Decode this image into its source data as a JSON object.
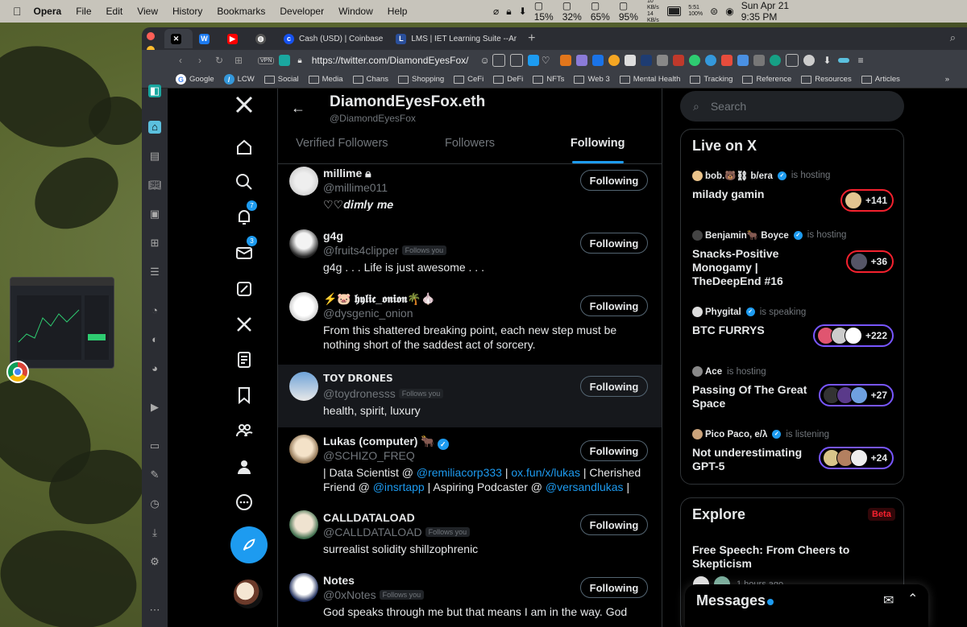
{
  "menubar": {
    "app": "Opera",
    "menus": [
      "File",
      "Edit",
      "View",
      "History",
      "Bookmarks",
      "Developer",
      "Window",
      "Help"
    ],
    "stats": {
      "cpu": "15%",
      "mem": "32%",
      "disk": "65%",
      "battery_stat": "95%"
    },
    "net": {
      "up": "10 KB/s",
      "down": "14 KB/s"
    },
    "battery": {
      "time": "5:51",
      "pct": "100%"
    },
    "datetime": "Sun Apr 21  9:35 PM"
  },
  "browser": {
    "tabs": [
      {
        "label": ""
      },
      {
        "label": ""
      },
      {
        "label": ""
      },
      {
        "label": ""
      },
      {
        "label": "Cash (USD) | Coinbase"
      },
      {
        "label": "LMS | IET Learning Suite --Ar"
      }
    ],
    "vpn": "VPN",
    "url": "https://twitter.com/DiamondEyesFox/",
    "bookmarks": [
      "Google",
      "LCW",
      "Social",
      "Media",
      "Chans",
      "Shopping",
      "CeFi",
      "DeFi",
      "NFTs",
      "Web 3",
      "Mental Health",
      "Tracking",
      "Reference",
      "Resources",
      "Articles"
    ]
  },
  "nav": {
    "notifications_badge": "7",
    "messages_badge": "3"
  },
  "profile": {
    "name": "DiamondEyesFox.eth",
    "handle": "@DiamondEyesFox",
    "tabs": [
      "Verified Followers",
      "Followers",
      "Following"
    ]
  },
  "following": [
    {
      "name": "millime",
      "handle": "@millime011",
      "follows_you": "",
      "bio": "♡♡𝒅𝒊𝒎𝒍𝒚 𝒎𝒆",
      "button": "Following"
    },
    {
      "name": "g4g",
      "handle": "@fruits4clipper",
      "follows_you": "Follows you",
      "bio": "g4g . . . Life is just awesome . . .",
      "button": "Following"
    },
    {
      "name": "⚡🐷 𝖍𝖞𝖑𝖎𝖈_𝖔𝖓𝖎𝖔𝖓🌴🧄",
      "handle": "@dysgenic_onion",
      "follows_you": "",
      "bio": "From this shattered breaking point, each new step must be nothing short of the saddest act of sorcery.",
      "button": "Following"
    },
    {
      "name": "𝗧𝗢𝗬 𝗗𝗥𝗢𝗡𝗘𝗦",
      "handle": "@toydronesss",
      "follows_you": "Follows you",
      "bio": "health, spirit, luxury",
      "button": "Following"
    },
    {
      "name": "Lukas (computer) 🐂",
      "handle": "@SCHIZO_FREQ",
      "follows_you": "",
      "bio_parts": [
        "| Data Scientist @ ",
        "@remiliacorp333",
        " | ",
        "ox.fun/x/lukas",
        " | Cherished Friend @ ",
        "@insrtapp",
        " | Aspiring Podcaster @ ",
        "@versandlukas",
        " |"
      ],
      "button": "Following"
    },
    {
      "name": "CALLDATALOAD",
      "handle": "@CALLDATALOAD",
      "follows_you": "Follows you",
      "bio": "surrealist solidity shillzophrenic",
      "button": "Following"
    },
    {
      "name": "Notes",
      "handle": "@0xNotes",
      "follows_you": "Follows you",
      "bio": "God speaks through me but that means I am in the way. God",
      "button": "Following"
    }
  ],
  "search": {
    "placeholder": "Search"
  },
  "live": {
    "title": "Live on X",
    "spaces": [
      {
        "host": "bob.🐻⛓ b/era",
        "status": "is hosting",
        "title": "milady gamin",
        "count": "+141",
        "ring": "red"
      },
      {
        "host": "Benjamin🐂 Boyce",
        "status": "is hosting",
        "title": "Snacks-Positive Monogamy | TheDeepEnd #16",
        "count": "+36",
        "ring": "red"
      },
      {
        "host": "Phygital",
        "status": "is speaking",
        "title": "BTC FURRYS",
        "count": "+222",
        "ring": "purple"
      },
      {
        "host": "Ace",
        "status": "is hosting",
        "title": "Passing Of The Great Space",
        "count": "+27",
        "ring": "purple"
      },
      {
        "host": "Pico Paco, e/λ",
        "status": "is listening",
        "title": "Not underestimating GPT-5",
        "count": "+24",
        "ring": "purple"
      }
    ]
  },
  "explore": {
    "title": "Explore",
    "badge": "Beta",
    "headline": "Free Speech: From Cheers to Skepticism",
    "meta": "1 hours ago"
  },
  "messages": {
    "title": "Messages"
  },
  "colors": {
    "accent": "#1d9bf0",
    "live_red": "#f4212e",
    "live_purple": "#7856ff"
  }
}
